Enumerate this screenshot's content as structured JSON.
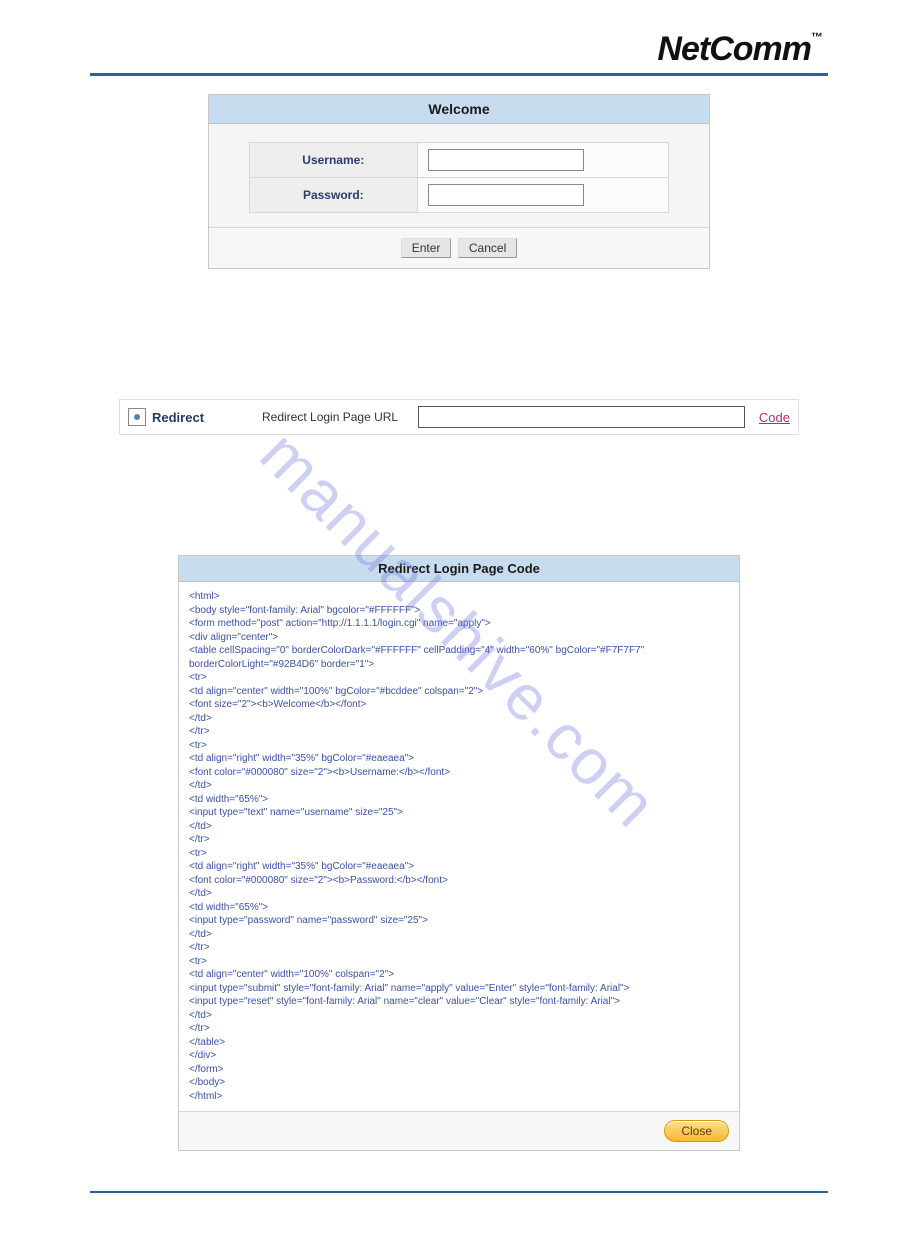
{
  "brand": {
    "name": "NetComm",
    "tm": "™"
  },
  "welcome": {
    "title": "Welcome",
    "username_label": "Username:",
    "password_label": "Password:",
    "enter_label": "Enter",
    "cancel_label": "Cancel"
  },
  "redirect": {
    "option_label": "Redirect",
    "field_label": "Redirect Login Page URL",
    "code_link": "Code"
  },
  "code_panel": {
    "title": "Redirect Login Page Code",
    "close_label": "Close",
    "code": "<html>\n<body style=\"font-family: Arial\" bgcolor=\"#FFFFFF\">\n<form method=\"post\" action=\"http://1.1.1.1/login.cgi\" name=\"apply\">\n<div align=\"center\">\n<table cellSpacing=\"0\" borderColorDark=\"#FFFFFF\" cellPadding=\"4\" width=\"60%\" bgColor=\"#F7F7F7\" borderColorLight=\"#92B4D6\" border=\"1\">\n<tr>\n<td align=\"center\" width=\"100%\" bgColor=\"#bcddee\" colspan=\"2\">\n<font size=\"2\"><b>Welcome</b></font>\n</td>\n</tr>\n<tr>\n<td align=\"right\" width=\"35%\" bgColor=\"#eaeaea\">\n<font color=\"#000080\" size=\"2\"><b>Username:</b></font>\n</td>\n<td width=\"65%\">\n<input type=\"text\" name=\"username\" size=\"25\">\n</td>\n</tr>\n<tr>\n<td align=\"right\" width=\"35%\" bgColor=\"#eaeaea\">\n<font color=\"#000080\" size=\"2\"><b>Password:</b></font>\n</td>\n<td width=\"65%\">\n<input type=\"password\" name=\"password\" size=\"25\">\n</td>\n</tr>\n<tr>\n<td align=\"center\" width=\"100%\" colspan=\"2\">\n<input type=\"submit\" style=\"font-family: Arial\" name=\"apply\" value=\"Enter\" style=\"font-family: Arial\">\n<input type=\"reset\" style=\"font-family: Arial\" name=\"clear\" value=\"Clear\" style=\"font-family: Arial\">\n</td>\n</tr>\n</table>\n</div>\n</form>\n</body>\n</html>"
  },
  "watermark": "manualshive.com"
}
